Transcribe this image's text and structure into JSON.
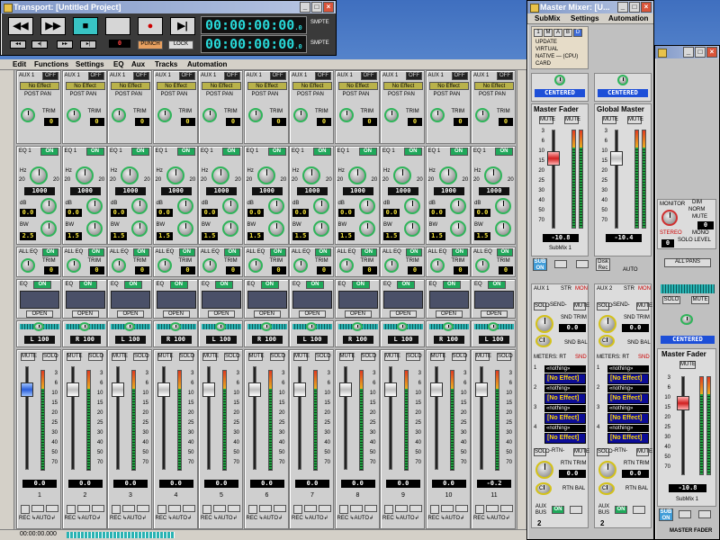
{
  "transport": {
    "title": "Transport: [Untitled Project]",
    "buttons": [
      "◀◀",
      "▶▶",
      "■",
      "",
      "●",
      "▶|"
    ],
    "punch_label": "PUNCH",
    "lock_label": "LOCK",
    "counter_value": "0",
    "time_top": "00:00:00:00",
    "time_top_suffix": ".0",
    "time_bottom": "00:00:00:00",
    "time_bottom_suffix": ".0",
    "smpte": "SMPTE"
  },
  "menu": [
    "Edit",
    "Functions",
    "Settings",
    "EQ",
    "Aux",
    "Tracks",
    "Automation"
  ],
  "strips": [
    {
      "num": "1",
      "pan": "L 100",
      "eq_gain": "0.0",
      "eq_bw": "2.5",
      "hz": "1000",
      "trim": "0",
      "fader": "0.0",
      "scale": [
        "3",
        "6",
        "10",
        "15",
        "20",
        "25",
        "30",
        "40",
        "50",
        "70"
      ]
    },
    {
      "num": "2",
      "pan": "R 100",
      "eq_gain": "0.0",
      "eq_bw": "1.5",
      "hz": "1000",
      "trim": "0",
      "fader": "0.0",
      "scale": [
        "3",
        "6",
        "10",
        "15",
        "20",
        "25",
        "30",
        "40",
        "50",
        "70"
      ]
    },
    {
      "num": "3",
      "pan": "L 100",
      "eq_gain": "0.0",
      "eq_bw": "1.5",
      "hz": "1000",
      "trim": "0",
      "fader": "0.0",
      "scale": [
        "3",
        "6",
        "10",
        "15",
        "20",
        "25",
        "30",
        "40",
        "50",
        "70"
      ]
    },
    {
      "num": "4",
      "pan": "R 100",
      "eq_gain": "0.0",
      "eq_bw": "1.5",
      "hz": "1000",
      "trim": "0",
      "fader": "0.0",
      "scale": [
        "3",
        "6",
        "10",
        "15",
        "20",
        "25",
        "30",
        "40",
        "50",
        "70"
      ]
    },
    {
      "num": "5",
      "pan": "L 100",
      "eq_gain": "0.0",
      "eq_bw": "1.5",
      "hz": "1000",
      "trim": "0",
      "fader": "0.0",
      "scale": [
        "3",
        "6",
        "10",
        "15",
        "20",
        "25",
        "30",
        "40",
        "50",
        "70"
      ]
    },
    {
      "num": "6",
      "pan": "R 100",
      "eq_gain": "0.0",
      "eq_bw": "1.5",
      "hz": "1000",
      "trim": "0",
      "fader": "0.0",
      "scale": [
        "3",
        "6",
        "10",
        "15",
        "20",
        "25",
        "30",
        "40",
        "50",
        "70"
      ]
    },
    {
      "num": "7",
      "pan": "L 100",
      "eq_gain": "0.0",
      "eq_bw": "1.5",
      "hz": "1000",
      "trim": "0",
      "fader": "0.0",
      "scale": [
        "3",
        "6",
        "10",
        "15",
        "20",
        "25",
        "30",
        "40",
        "50",
        "70"
      ]
    },
    {
      "num": "8",
      "pan": "R 100",
      "eq_gain": "0.0",
      "eq_bw": "1.5",
      "hz": "1000",
      "trim": "0",
      "fader": "0.0",
      "scale": [
        "3",
        "6",
        "10",
        "15",
        "20",
        "25",
        "30",
        "40",
        "50",
        "70"
      ]
    },
    {
      "num": "9",
      "pan": "L 100",
      "eq_gain": "0.0",
      "eq_bw": "1.5",
      "hz": "1000",
      "trim": "0",
      "fader": "0.0",
      "scale": [
        "3",
        "6",
        "10",
        "15",
        "20",
        "25",
        "30",
        "40",
        "50",
        "70"
      ]
    },
    {
      "num": "10",
      "pan": "R 100",
      "eq_gain": "0.0",
      "eq_bw": "1.5",
      "hz": "1000",
      "trim": "0",
      "fader": "0.0",
      "scale": [
        "3",
        "6",
        "10",
        "15",
        "20",
        "25",
        "30",
        "40",
        "50",
        "70"
      ]
    },
    {
      "num": "11",
      "pan": "L 100",
      "eq_gain": "0.0",
      "eq_bw": "1.5",
      "hz": "1000",
      "trim": "0",
      "fader": "-0.2",
      "scale": [
        "3",
        "6",
        "10",
        "15",
        "20",
        "25",
        "30",
        "40",
        "50",
        "70"
      ]
    }
  ],
  "strip_labels": {
    "aux": "AUX 1",
    "off": "OFF",
    "on": "ON",
    "no_effect": "No Effect",
    "post_pan": "POST PAN",
    "trim": "TRIM",
    "eq1": "EQ 1",
    "hz": "Hz",
    "db": "dB",
    "bw": "BW",
    "all_eq": "ALL EQ",
    "eq": "EQ",
    "open": "OPEN",
    "mute": "MUTE",
    "solo": "SOLO",
    "rec": "REC",
    "auto": "↳AUTO↲",
    "eq_min": "20",
    "eq_max": "20"
  },
  "status": {
    "time": "00:00:00.000"
  },
  "master_mixer": {
    "title": "Master Mixer: [U...",
    "menu": [
      "SubMix",
      "Settings",
      "Automation"
    ],
    "options": [
      "UPDATE",
      "VIRTUAL",
      "NATIVE — (CPU)",
      "CARD"
    ],
    "tabs": [
      "1",
      "M",
      "A",
      "B",
      "D"
    ],
    "centered": "CENTERED",
    "master_fader_title": "Master Fader",
    "global_master_title": "Global Master",
    "master_fader_value": "-10.8",
    "global_master_value": "-10.4",
    "submix_label": "SubMix 1",
    "mute": "MUTE",
    "sub_on": "SUB ON",
    "disk_rec": "Disk Rec",
    "auto": "AUTO",
    "aux1": "AUX 1",
    "aux2": "AUX 2",
    "str": "STR",
    "mon": "MON",
    "solo": "SOLO",
    "send": "-SEND-",
    "snd_trim": "SND TRIM",
    "snd_bal": "SND BAL",
    "knob_c": "C",
    "snd_value": "0.0",
    "meters": "METERS: RT",
    "snd": "SND",
    "fx": [
      "[No Effect]",
      "[No Effect]",
      "[No Effect]",
      "[No Effect]"
    ],
    "fx_slots": [
      "1",
      "2",
      "3",
      "4"
    ],
    "fx_names": [
      "«nothing»",
      "«nothing»",
      "«nothing»",
      "«nothing»"
    ],
    "rtn": "-RTN-",
    "rtn_trim": "RTN TRIM",
    "rtn_bal": "RTN BAL",
    "rtn_value": "0.0",
    "aux_bus": "AUX BUS",
    "aux_bus_num": "2",
    "scale": [
      "3",
      "6",
      "10",
      "15",
      "20",
      "25",
      "30",
      "40",
      "50",
      "70"
    ]
  },
  "master2": {
    "monitor": "MONITOR",
    "dim": "DIM",
    "norm": "NORM",
    "mute": "MUTE",
    "dim_value": "0",
    "stereo": "STEREO",
    "mono": "MONO",
    "solo_level": "SOLO LEVEL",
    "solo_value": "0",
    "all_pans": "ALL PANS",
    "solo": "SOLO",
    "centered": "CENTERED",
    "master_fader": "Master Fader",
    "mute_btn": "MUTE",
    "value": "-10.8",
    "submix": "SubMix 1",
    "sub_on": "SUB ON",
    "footer": "MASTER FADER",
    "scale": [
      "3",
      "6",
      "10",
      "15",
      "20",
      "25",
      "30",
      "40",
      "50",
      "70"
    ]
  }
}
